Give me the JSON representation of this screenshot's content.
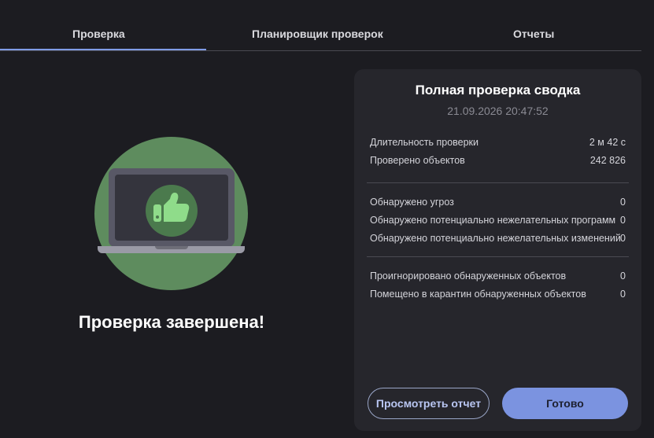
{
  "tabs": [
    {
      "label": "Проверка",
      "active": true
    },
    {
      "label": "Планировщик проверок",
      "active": false
    },
    {
      "label": "Отчеты",
      "active": false
    }
  ],
  "hero": {
    "title": "Проверка завершена!",
    "icon": "thumbs-up-laptop-icon"
  },
  "summary": {
    "title": "Полная проверка сводка",
    "date": "21.09.2026 20:47:52",
    "group1": [
      {
        "label": "Длительность проверки",
        "value": "2 м 42 с"
      },
      {
        "label": "Проверено объектов",
        "value": "242 826"
      }
    ],
    "group2": [
      {
        "label": "Обнаружено угроз",
        "value": "0"
      },
      {
        "label": "Обнаружено потенциально нежелательных программ",
        "value": "0"
      },
      {
        "label": "Обнаружено потенциально нежелательных изменений",
        "value": "0"
      }
    ],
    "group3": [
      {
        "label": "Проигнорировано обнаруженных объектов",
        "value": "0"
      },
      {
        "label": "Помещено в карантин обнаруженных объектов",
        "value": "0"
      }
    ]
  },
  "buttons": {
    "view_report": "Просмотреть отчет",
    "done": "Готово"
  },
  "colors": {
    "background": "#1c1c21",
    "card": "#26262c",
    "accent": "#7b93e0",
    "circle": "#5e8c5e",
    "thumb": "#8fdc8a"
  }
}
